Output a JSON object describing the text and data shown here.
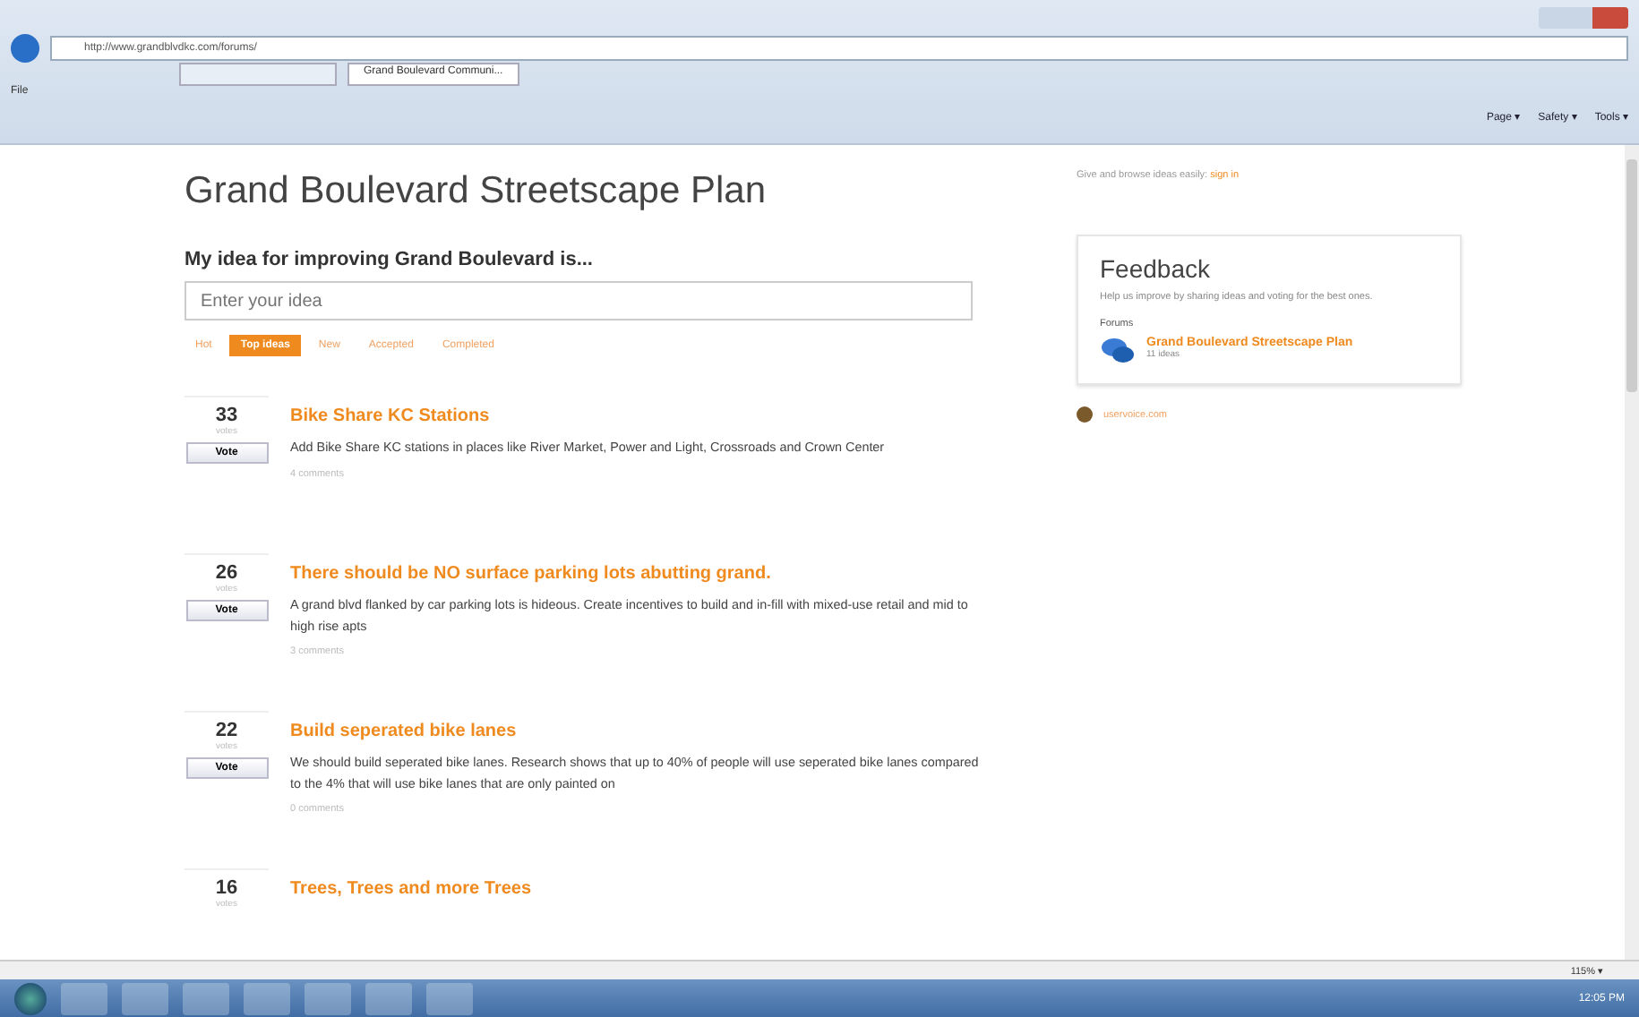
{
  "browser": {
    "address": "http://www.grandblvdkc.com/forums/",
    "tabs": [
      {
        "selected": false
      },
      {
        "label": "Grand Boulevard Communi...",
        "selected": true
      }
    ],
    "menu": [
      "File"
    ],
    "commands": [
      "Page ▾",
      "Safety ▾",
      "Tools ▾"
    ]
  },
  "page": {
    "title": "Grand Boulevard Streetscape Plan",
    "prompt": "My idea for improving Grand Boulevard is...",
    "idea_field": {
      "placeholder": "Enter your idea"
    },
    "filters": [
      {
        "label": "Hot",
        "selected": false
      },
      {
        "label": "Top ideas",
        "selected": true
      },
      {
        "label": "New",
        "selected": false
      },
      {
        "label": "Accepted",
        "selected": false
      },
      {
        "label": "Completed",
        "selected": false
      }
    ],
    "ideas": [
      {
        "votes": "33",
        "votes_label": "votes",
        "vote_button": "Vote",
        "title": "Bike Share KC Stations",
        "description": "Add Bike Share KC stations in places like River Market, Power and Light, Crossroads and Crown Center",
        "comments": "4 comments"
      },
      {
        "votes": "26",
        "votes_label": "votes",
        "vote_button": "Vote",
        "title": "There should be NO surface parking lots abutting grand.",
        "description": "A grand blvd flanked by car parking lots is hideous. Create incentives to build and in-fill with mixed-use retail and mid to high rise apts",
        "comments": "3 comments"
      },
      {
        "votes": "22",
        "votes_label": "votes",
        "vote_button": "Vote",
        "title": "Build seperated bike lanes",
        "description": "We should build seperated bike lanes. Research shows that up to 40% of people will use seperated bike lanes compared to the 4% that will use bike lanes that are only painted on",
        "comments": "0 comments"
      },
      {
        "votes": "16",
        "votes_label": "votes",
        "title": "Trees, Trees and more Trees"
      }
    ]
  },
  "sidebar": {
    "signin_text": "Give and browse ideas easily:",
    "signin_link": "sign in",
    "feedback": {
      "title": "Feedback",
      "text": "Help us improve by sharing ideas and voting for the best ones.",
      "forums_label": "Forums",
      "forum": {
        "name": "Grand Boulevard Streetscape Plan",
        "count": "11 ideas"
      }
    },
    "powered": "uservoice.com"
  },
  "status_bar": {
    "zoom": "115% ▾"
  },
  "taskbar": {
    "clock": "12:05 PM"
  }
}
